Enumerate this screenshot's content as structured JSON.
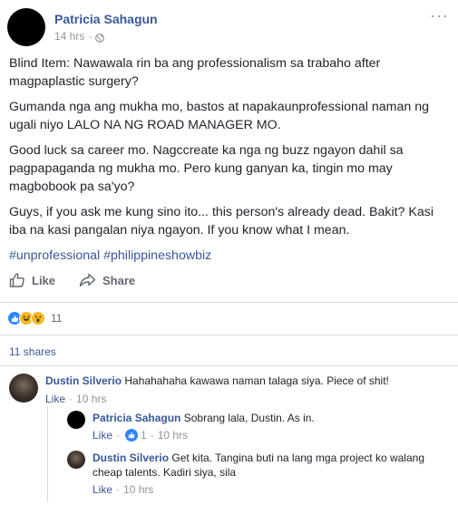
{
  "post": {
    "author": "Patricia Sahagun",
    "time": "14 hrs",
    "dot": "·",
    "more": "···",
    "paragraphs": [
      "Blind Item: Nawawala rin ba ang professionalism sa trabaho after magpaplastic surgery?",
      "Gumanda nga ang mukha mo, bastos at napakaunprofessional naman ng ugali niyo LALO NA NG ROAD MANAGER MO.",
      "Good luck sa career mo. Nagccreate ka nga ng buzz ngayon dahil sa pagpapaganda ng mukha mo. Pero kung ganyan ka, tingin mo may magbobook pa sa'yo?",
      "Guys, if you ask me kung sino ito... this person's already dead. Bakit? Kasi iba na kasi pangalan niya ngayon. If you know what I mean."
    ],
    "hashtags": [
      "#unprofessional",
      "#philippineshowbiz"
    ]
  },
  "actions": {
    "like": "Like",
    "share": "Share"
  },
  "reactions": {
    "count": "11",
    "types": [
      "like-icon",
      "haha-icon",
      "wow-icon"
    ]
  },
  "shares": "11 shares",
  "comments": [
    {
      "name": "Dustin Silverio",
      "text": "Hahahahaha kawawa naman talaga siya. Piece of shit!",
      "like": "Like",
      "time": "10 hrs"
    }
  ],
  "replies": [
    {
      "name": "Patricia Sahagun",
      "text": "Sobrang lala, Dustin. As in.",
      "like": "Like",
      "likes": "1",
      "time": "10 hrs"
    },
    {
      "name": "Dustin Silverio",
      "text": "Get kita. Tangina buti na lang mga project ko walang cheap talents. Kadiri siya, sila",
      "like": "Like",
      "time": "10 hrs"
    }
  ],
  "colors": {
    "link": "#385898",
    "muted": "#90949c",
    "like_blue": "#2d88ff",
    "reaction_yellow": "#f7b928"
  }
}
